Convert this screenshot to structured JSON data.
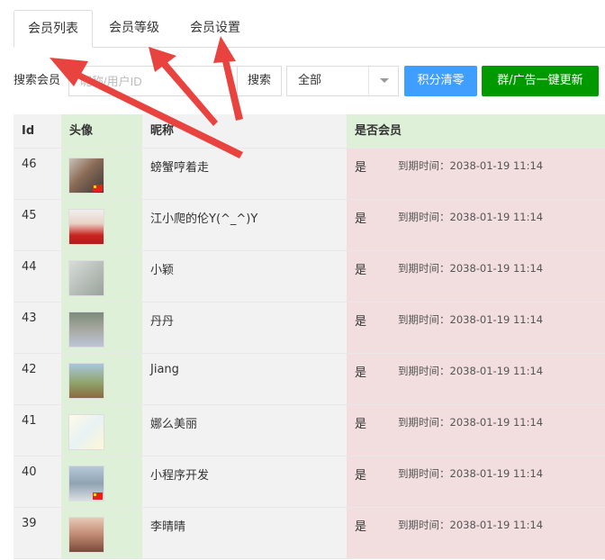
{
  "tabs": [
    {
      "label": "会员列表",
      "active": true
    },
    {
      "label": "会员等级",
      "active": false
    },
    {
      "label": "会员设置",
      "active": false
    }
  ],
  "toolbar": {
    "search_label": "搜索会员",
    "search_placeholder": "昵称/用户ID",
    "search_button": "搜索",
    "filter_value": "全部",
    "clear_points_button": "积分清零",
    "update_button": "群/广告一键更新",
    "colors": {
      "blue": "#409eff",
      "green": "#009a00"
    }
  },
  "table": {
    "headers": {
      "id": "Id",
      "avatar": "头像",
      "nickname": "昵称",
      "member": "是否会员"
    },
    "rows": [
      {
        "id": "46",
        "nickname": "螃蟹哼着走",
        "member": "是",
        "expire": "到期时间：2038-01-19 11:14"
      },
      {
        "id": "45",
        "nickname": "江小爬的伦Y(^_^)Y",
        "member": "是",
        "expire": "到期时间：2038-01-19 11:14"
      },
      {
        "id": "44",
        "nickname": "小颖",
        "member": "是",
        "expire": "到期时间：2038-01-19 11:14"
      },
      {
        "id": "43",
        "nickname": "丹丹",
        "member": "是",
        "expire": "到期时间：2038-01-19 11:14"
      },
      {
        "id": "42",
        "nickname": "Jiang",
        "member": "是",
        "expire": "到期时间：2038-01-19 11:14"
      },
      {
        "id": "41",
        "nickname": "娜么美丽",
        "member": "是",
        "expire": "到期时间：2038-01-19 11:14"
      },
      {
        "id": "40",
        "nickname": "小程序开发",
        "member": "是",
        "expire": "到期时间：2038-01-19 11:14"
      },
      {
        "id": "39",
        "nickname": "李晴晴",
        "member": "是",
        "expire": "到期时间：2038-01-19 11:14"
      }
    ]
  },
  "annotation_color": "#e8433f"
}
